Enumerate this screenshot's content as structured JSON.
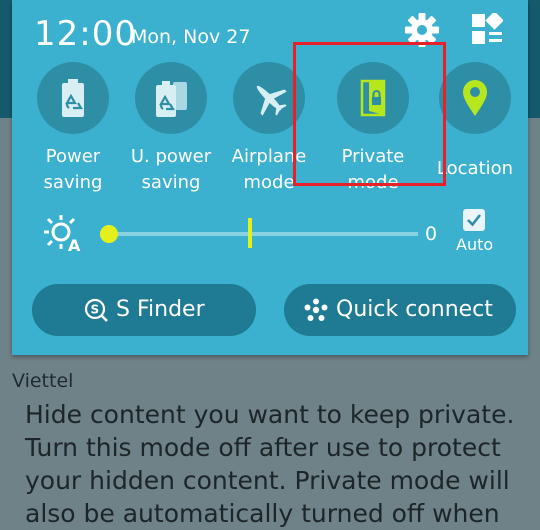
{
  "status": {
    "time": "12:00",
    "date": "Mon, Nov 27"
  },
  "quick_toggles": [
    {
      "label": "Power\nsaving",
      "icon": "battery-recycle-icon"
    },
    {
      "label": "U. power\nsaving",
      "icon": "double-battery-recycle-icon"
    },
    {
      "label": "Airplane\nmode",
      "icon": "airplane-icon"
    },
    {
      "label": "Private\nmode",
      "icon": "private-lock-icon",
      "highlighted": true
    },
    {
      "label": "Location",
      "icon": "location-pin-icon"
    }
  ],
  "brightness": {
    "value_label": "0",
    "level": 0,
    "auto_label": "Auto",
    "auto_checked": true
  },
  "buttons": {
    "sfinder": "S Finder",
    "quick_connect": "Quick connect"
  },
  "background": {
    "carrier": "Viettel",
    "description": "Hide content you want to keep private. Turn this mode off after use to protect your hidden content. Private mode will also be automatically turned off when"
  },
  "colors": {
    "panel": "#3bb0cf",
    "tile": "#2e8ea6",
    "accent": "#e4f01a",
    "highlight": "#e8202a"
  }
}
